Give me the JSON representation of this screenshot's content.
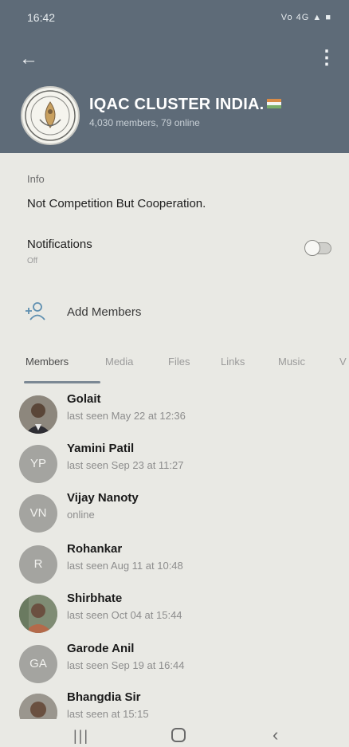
{
  "status_bar": {
    "time": "16:42",
    "icons": "Vo 4G ▲ ■"
  },
  "header": {
    "back_icon": "arrow-left-icon",
    "menu_icon": "more-vertical-icon",
    "group_name": "IQAC CLUSTER INDIA.",
    "subtitle": "4,030 members, 79 online"
  },
  "info": {
    "label": "Info",
    "description": "Not Competition But Cooperation."
  },
  "notifications": {
    "label": "Notifications",
    "state": "Off",
    "enabled": false
  },
  "add_members": {
    "label": "Add Members",
    "icon": "add-person-icon"
  },
  "tabs": [
    "Members",
    "Media",
    "Files",
    "Links",
    "Music",
    "V"
  ],
  "active_tab": "Members",
  "members": [
    {
      "name": "Golait",
      "status": "last seen May 22 at 12:36",
      "avatar": "photo"
    },
    {
      "name": "Yamini Patil",
      "status": "last seen Sep 23 at 11:27",
      "avatar": "YP"
    },
    {
      "name": "Vijay Nanoty",
      "status": "online",
      "avatar": "VN"
    },
    {
      "name": "Rohankar",
      "status": "last seen Aug 11 at 10:48",
      "avatar": "R"
    },
    {
      "name": "Shirbhate",
      "status": "last seen Oct 04 at 15:44",
      "avatar": "photo"
    },
    {
      "name": "Garode Anil",
      "status": "last seen Sep 19 at 16:44",
      "avatar": "GA"
    },
    {
      "name": "Bhangdia Sir",
      "status": "last seen at 15:15",
      "avatar": "photo"
    }
  ],
  "nav_bar": {
    "recent_icon": "recent-apps-icon",
    "home_icon": "home-icon",
    "back_icon": "back-icon"
  },
  "colors": {
    "header": "#5e6b78",
    "background": "#e9e9e4",
    "avatar_placeholder": "#a4a4a0"
  }
}
